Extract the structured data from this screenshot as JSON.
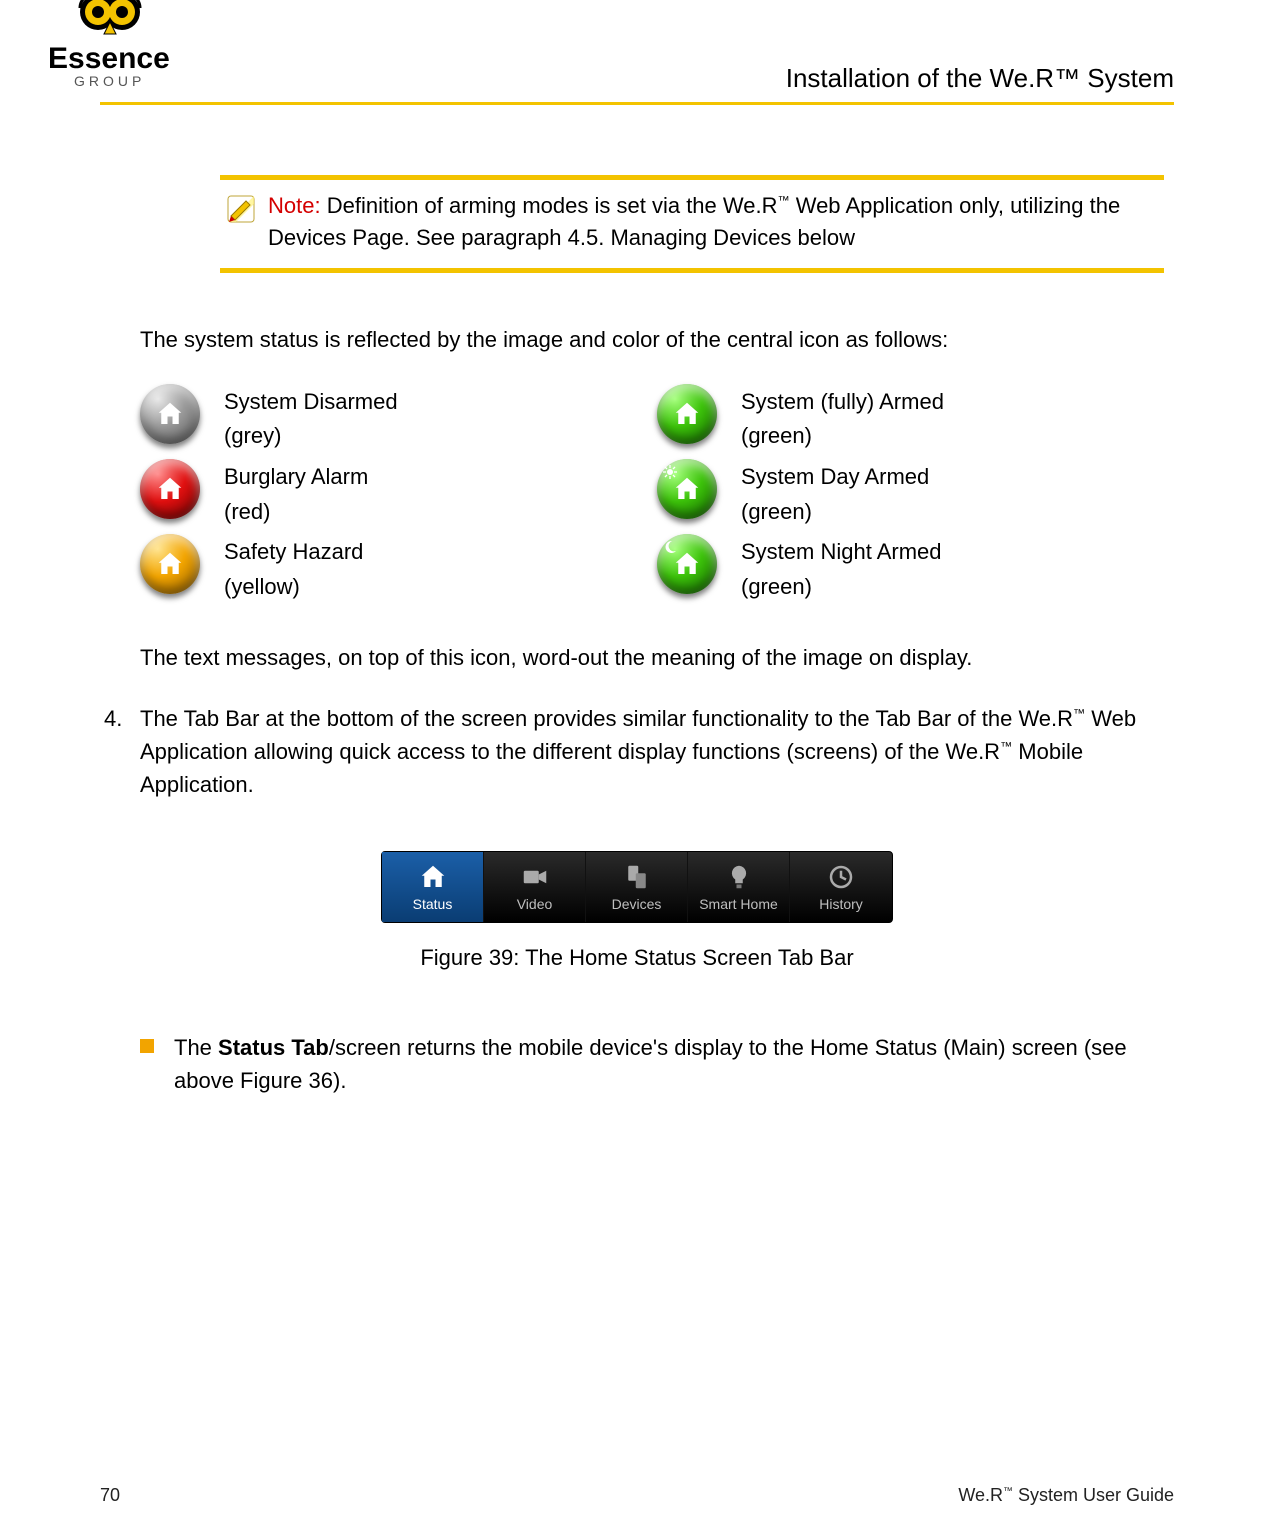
{
  "header": {
    "title": "Installation of the We.R™ System",
    "brand_name": "Essence",
    "brand_sub": "GROUP"
  },
  "note": {
    "label": "Note:",
    "text_parts": {
      "a": " Definition of arming modes is set via the We.R",
      "b": " Web Application only, utilizing the Devices Page. See paragraph 4.5. Managing Devices below"
    }
  },
  "para_intro": "The system status is reflected by the image and color of the central icon as follows:",
  "status": {
    "disarmed": {
      "label": "System Disarmed",
      "color": "(grey)"
    },
    "fully_armed": {
      "label": "System (fully) Armed",
      "color": "(green)"
    },
    "burglary": {
      "label": "Burglary Alarm",
      "color": "(red)"
    },
    "day_armed": {
      "label": "System Day Armed",
      "color": "(green)"
    },
    "safety": {
      "label": "Safety Hazard",
      "color": "(yellow)"
    },
    "night_armed": {
      "label": "System Night Armed",
      "color": "(green)"
    }
  },
  "para_after_icons": "The text messages, on top of this icon, word-out the meaning of the image on display.",
  "item4": {
    "num": "4.",
    "a": "The Tab Bar at the bottom of the screen provides similar functionality to the Tab Bar of the We.R",
    "b": " Web Application allowing quick access to the different display functions (screens) of the We.R",
    "c": " Mobile Application."
  },
  "tabs": {
    "status": "Status",
    "video": "Video",
    "devices": "Devices",
    "smart_home": "Smart Home",
    "history": "History"
  },
  "figure_caption": "Figure 39: The Home Status Screen Tab Bar",
  "bullet": {
    "a": "The ",
    "b": "Status Tab",
    "c": "/screen returns the mobile device's display to the Home Status (Main) screen (see above Figure 36)."
  },
  "footer": {
    "page": "70",
    "guide_a": "We.R",
    "guide_b": " System User Guide"
  }
}
